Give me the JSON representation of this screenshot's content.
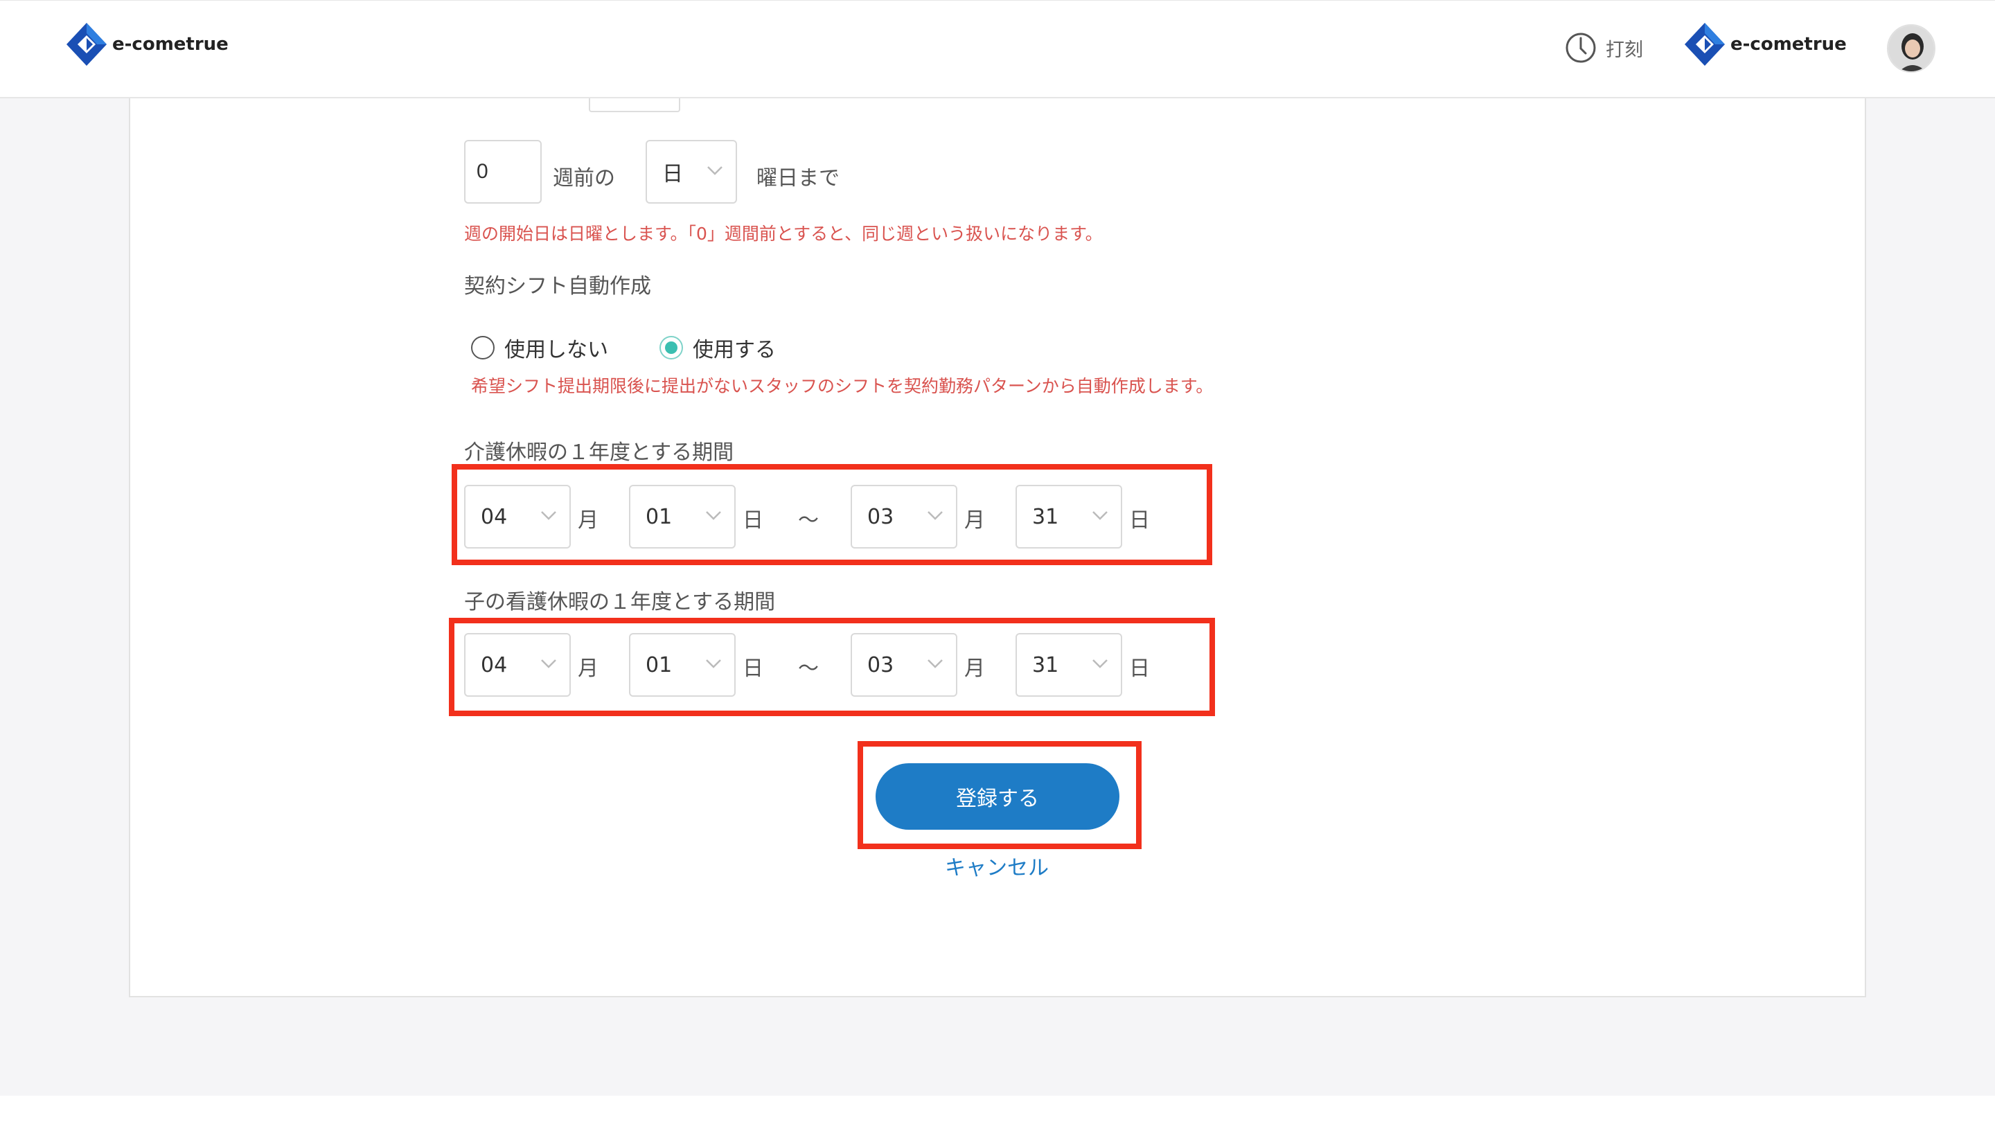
{
  "header": {
    "brand_left": "e-cometrue",
    "brand_right": "e-cometrue",
    "clock_label": "打刻"
  },
  "deadline_row": {
    "weeks_value": "0",
    "weeks_suffix": "週前の",
    "weekday_selected": "日",
    "weekday_suffix": "曜日まで",
    "note": "週の開始日は日曜とします。「0」週間前とすると、同じ週という扱いになります。"
  },
  "auto_shift": {
    "title": "契約シフト自動作成",
    "option_off": "使用しない",
    "option_on": "使用する",
    "selected": "使用する",
    "note": "希望シフト提出期限後に提出がないスタッフのシフトを契約勤務パターンから自動作成します。"
  },
  "care_leave": {
    "title": "介護休暇の１年度とする期間",
    "start_month": "04",
    "start_day": "01",
    "end_month": "03",
    "end_day": "31"
  },
  "child_care_leave": {
    "title": "子の看護休暇の１年度とする期間",
    "start_month": "04",
    "start_day": "01",
    "end_month": "03",
    "end_day": "31"
  },
  "units": {
    "month": "月",
    "day": "日",
    "tilde": "〜"
  },
  "actions": {
    "submit_label": "登録する",
    "cancel_label": "キャンセル"
  },
  "colors": {
    "primary": "#1e7cc6",
    "highlight": "#f2301c",
    "note": "#d9534f",
    "radio_on": "#3bbfb1"
  }
}
